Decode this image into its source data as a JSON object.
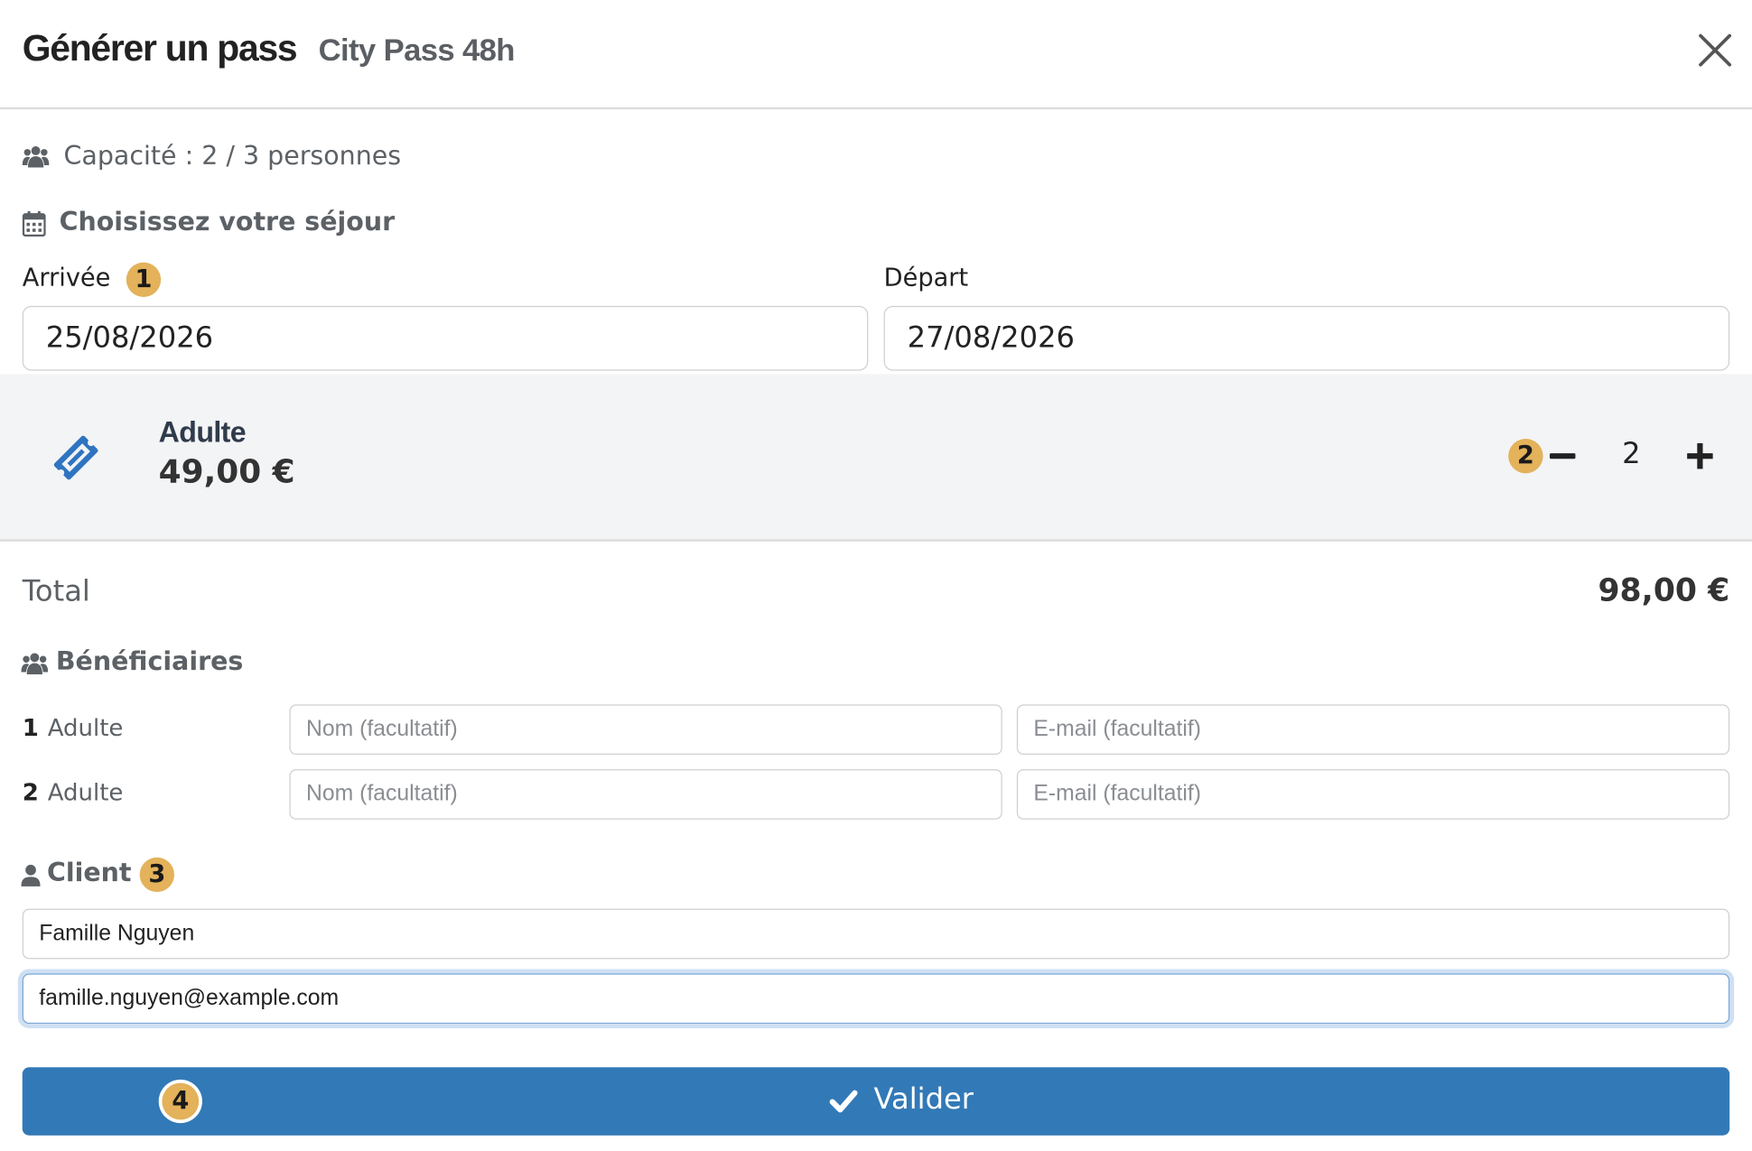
{
  "header": {
    "title": "Générer un pass",
    "subtitle": "City Pass 48h"
  },
  "capacity": {
    "text": "Capacité : 2 / 3 personnes",
    "icon": "users-icon"
  },
  "stay": {
    "section_title": "Choisissez votre séjour",
    "icon": "calendar-icon",
    "arrival_label": "Arrivée",
    "arrival_value": "25/08/2026",
    "departure_label": "Départ",
    "departure_value": "27/08/2026"
  },
  "product": {
    "icon": "ticket-icon",
    "name": "Adulte",
    "price": "49,00 €",
    "quantity": "2"
  },
  "total": {
    "label": "Total",
    "value": "98,00 €"
  },
  "beneficiaries": {
    "section_title": "Bénéficiaires",
    "icon": "users-icon",
    "rows": [
      {
        "index": "1",
        "type": "Adulte",
        "name_placeholder": "Nom (facultatif)",
        "email_placeholder": "E-mail (facultatif)"
      },
      {
        "index": "2",
        "type": "Adulte",
        "name_placeholder": "Nom (facultatif)",
        "email_placeholder": "E-mail (facultatif)"
      }
    ]
  },
  "client": {
    "section_title": "Client",
    "icon": "user-icon",
    "name_value": "Famille Nguyen",
    "email_value": "famille.nguyen@example.com"
  },
  "submit": {
    "label": "Valider",
    "icon": "check-icon"
  },
  "badges": [
    "1",
    "2",
    "3",
    "4"
  ],
  "colors": {
    "primary": "#3279b7",
    "badge": "#e3b25a",
    "ticket_icon": "#2f74c0",
    "panel_bg": "#f3f4f6"
  }
}
